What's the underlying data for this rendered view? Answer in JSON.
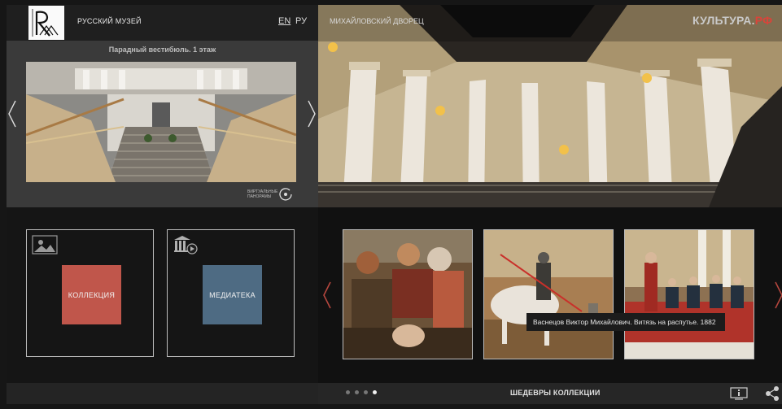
{
  "header": {
    "museum_name": "РУССКИЙ МУЗЕЙ",
    "lang_en": "EN",
    "lang_ru": "РУ"
  },
  "panorama": {
    "title": "Парадный вестибюль. 1 этаж",
    "virtual_label": "ВИРТУАЛЬНЫЕ ПАНОРАМЫ"
  },
  "tiles": [
    {
      "label": "КОЛЛЕКЦИЯ",
      "icon": "painting-icon"
    },
    {
      "label": "МЕДИАТЕКА",
      "icon": "museum-play-icon"
    }
  ],
  "hero": {
    "palace_name": "МИХАЙЛОВСКИЙ ДВОРЕЦ",
    "brand_main": "КУЛЬТУРА.",
    "brand_suffix": "РФ"
  },
  "gallery": {
    "tooltip": "Васнецов Виктор Михайлович. Витязь на распутье. 1882",
    "footer_title": "ШЕДЕВРЫ КОЛЛЕКЦИИ",
    "dots": 4,
    "active_dot": 4
  },
  "colors": {
    "collection": "#c0564b",
    "media": "#4e6b83",
    "brand_accent": "#d9443a"
  }
}
